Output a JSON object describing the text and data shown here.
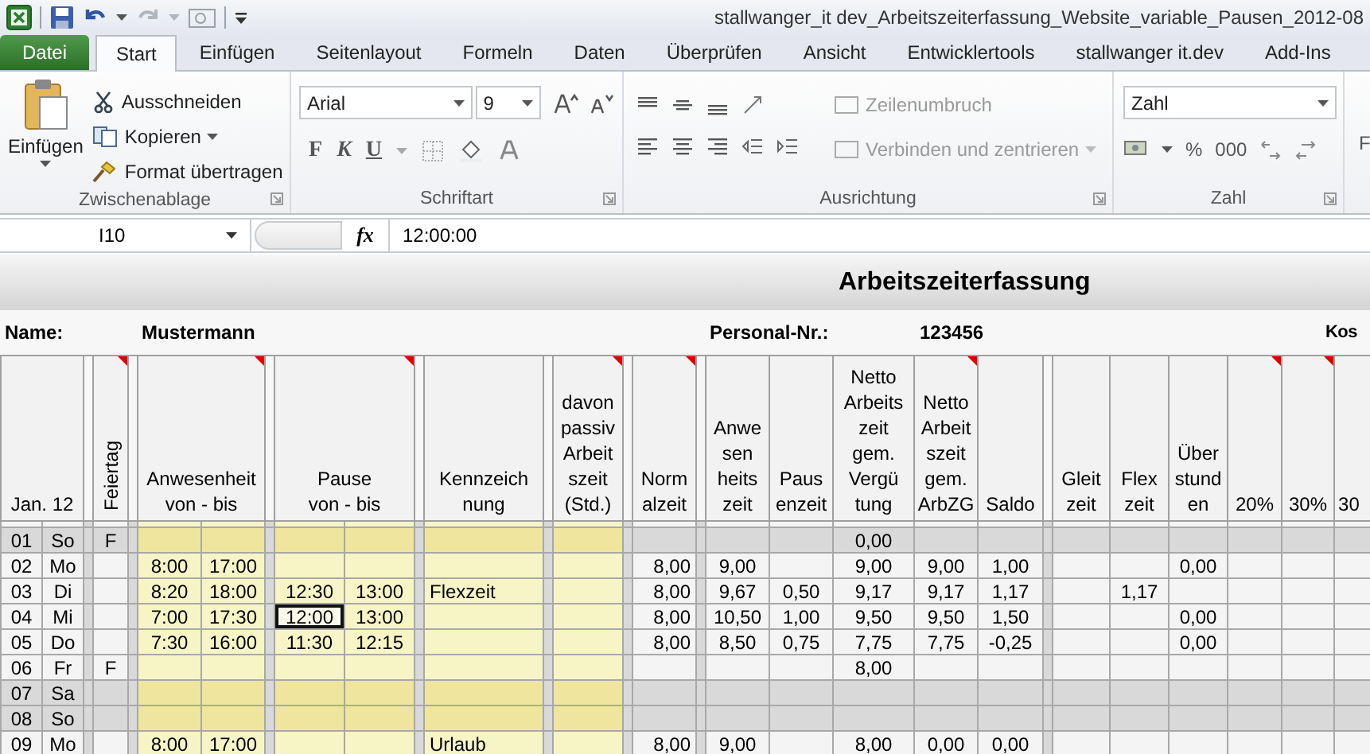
{
  "window": {
    "title": "stallwanger_it dev_Arbeitszeiterfassung_Website_variable_Pausen_2012-08"
  },
  "tabs": [
    {
      "label": "Datei",
      "kind": "file",
      "selected": false
    },
    {
      "label": "Start",
      "kind": "tab",
      "selected": true
    },
    {
      "label": "Einfügen",
      "kind": "tab",
      "selected": false
    },
    {
      "label": "Seitenlayout",
      "kind": "tab",
      "selected": false
    },
    {
      "label": "Formeln",
      "kind": "tab",
      "selected": false
    },
    {
      "label": "Daten",
      "kind": "tab",
      "selected": false
    },
    {
      "label": "Überprüfen",
      "kind": "tab",
      "selected": false
    },
    {
      "label": "Ansicht",
      "kind": "tab",
      "selected": false
    },
    {
      "label": "Entwicklertools",
      "kind": "tab",
      "selected": false
    },
    {
      "label": "stallwanger it.dev",
      "kind": "tab",
      "selected": false
    },
    {
      "label": "Add-Ins",
      "kind": "tab",
      "selected": false
    }
  ],
  "ribbon": {
    "groups": [
      {
        "kind": "clipboard",
        "label": "Zwischenablage",
        "paste": "Einfügen",
        "items": [
          {
            "kind": "cut",
            "label": "Ausschneiden"
          },
          {
            "kind": "copy",
            "label": "Kopieren"
          },
          {
            "kind": "painter",
            "label": "Format übertragen"
          }
        ]
      },
      {
        "kind": "font",
        "label": "Schriftart",
        "font": "Arial",
        "size": "9",
        "bold": "F",
        "italic": "K",
        "underline": "U"
      },
      {
        "kind": "alignment",
        "label": "Ausrichtung",
        "buttons": [
          {
            "kind": "wrap",
            "label": "Zeilenumbruch",
            "disabled": true
          },
          {
            "kind": "merge",
            "label": "Verbinden und zentrieren",
            "disabled": true
          }
        ]
      },
      {
        "kind": "number",
        "label": "Zahl",
        "format": "Zahl",
        "percent": "%",
        "thousands": "000"
      },
      {
        "kind": "partial",
        "label": "F"
      }
    ]
  },
  "formula_bar": {
    "cell": "I10",
    "function_button": "fx",
    "formula": "12:00:00"
  },
  "sheet": {
    "title": "Arbeitszeiterfassung",
    "name_label": "Name:",
    "name": "Mustermann",
    "personal_label": "Personal-Nr.:",
    "personal_number": "123456",
    "cut_label": "Kos",
    "header": [
      {
        "kind": "double",
        "text": "Jan. 12",
        "comment": false
      },
      {
        "kind": "spacer"
      },
      {
        "kind": "vertical",
        "text": "Feiertag",
        "comment": true
      },
      {
        "kind": "spacer"
      },
      {
        "kind": "pair",
        "text": "Anwesenheit\nvon - bis",
        "comment": true
      },
      {
        "kind": "spacer"
      },
      {
        "kind": "pair",
        "text": "Pause\nvon - bis",
        "comment": true
      },
      {
        "kind": "spacer"
      },
      {
        "kind": "single",
        "text": "Kennzeich\nnung",
        "comment": false
      },
      {
        "kind": "spacer"
      },
      {
        "kind": "single",
        "text": "davon\npassiv\nArbeit\nszeit\n(Std.)",
        "comment": true
      },
      {
        "kind": "spacer"
      },
      {
        "kind": "single",
        "text": "Norm\nalzeit",
        "comment": true
      },
      {
        "kind": "spacer"
      },
      {
        "kind": "single",
        "text": "Anwe\nsen\nheits\nzeit",
        "comment": false
      },
      {
        "kind": "single",
        "text": "Paus\nenzeit",
        "comment": false
      },
      {
        "kind": "single",
        "text": "Netto\nArbeits\nzeit\ngem.\nVergü\ntung",
        "comment": false
      },
      {
        "kind": "single",
        "text": "Netto\nArbeit\nszeit\ngem.\nArbZG",
        "comment": true
      },
      {
        "kind": "single",
        "text": "Saldo",
        "comment": false
      },
      {
        "kind": "spacer"
      },
      {
        "kind": "single",
        "text": "Gleit\nzeit",
        "comment": false
      },
      {
        "kind": "single",
        "text": "Flex\nzeit",
        "comment": false
      },
      {
        "kind": "single",
        "text": "Über\nstund\nen",
        "comment": false
      },
      {
        "kind": "single",
        "text": "20%",
        "comment": true
      },
      {
        "kind": "single",
        "text": "30%",
        "comment": true
      },
      {
        "kind": "single",
        "text": "30",
        "comment": false
      }
    ],
    "rows": [
      {
        "day": "01",
        "weekday": "So",
        "weekend": true,
        "selected": false,
        "holiday": "F",
        "net_pay": "0,00"
      },
      {
        "day": "02",
        "weekday": "Mo",
        "weekend": false,
        "selected": false,
        "presence_from": "8:00",
        "presence_to": "17:00",
        "normal": "8,00",
        "presence_hours": "9,00",
        "net_pay": "9,00",
        "net_arbzg": "9,00",
        "balance": "1,00",
        "overtime": "0,00"
      },
      {
        "day": "03",
        "weekday": "Di",
        "weekend": false,
        "selected": false,
        "presence_from": "8:20",
        "presence_to": "18:00",
        "break_from": "12:30",
        "break_to": "13:00",
        "remark": "Flexzeit",
        "normal": "8,00",
        "presence_hours": "9,67",
        "break_hours": "0,50",
        "net_pay": "9,17",
        "net_arbzg": "9,17",
        "balance": "1,17",
        "flex": "1,17"
      },
      {
        "day": "04",
        "weekday": "Mi",
        "weekend": false,
        "selected": true,
        "presence_from": "7:00",
        "presence_to": "17:30",
        "break_from": "12:00",
        "break_to": "13:00",
        "normal": "8,00",
        "presence_hours": "10,50",
        "break_hours": "1,00",
        "net_pay": "9,50",
        "net_arbzg": "9,50",
        "balance": "1,50",
        "overtime": "0,00"
      },
      {
        "day": "05",
        "weekday": "Do",
        "weekend": false,
        "selected": false,
        "presence_from": "7:30",
        "presence_to": "16:00",
        "break_from": "11:30",
        "break_to": "12:15",
        "normal": "8,00",
        "presence_hours": "8,50",
        "break_hours": "0,75",
        "net_pay": "7,75",
        "net_arbzg": "7,75",
        "balance": "-0,25",
        "overtime": "0,00"
      },
      {
        "day": "06",
        "weekday": "Fr",
        "weekend": false,
        "selected": false,
        "holiday": "F",
        "net_pay": "8,00"
      },
      {
        "day": "07",
        "weekday": "Sa",
        "weekend": true,
        "selected": false
      },
      {
        "day": "08",
        "weekday": "So",
        "weekend": true,
        "selected": false
      },
      {
        "day": "09",
        "weekday": "Mo",
        "weekend": false,
        "selected": false,
        "presence_from": "8:00",
        "presence_to": "17:00",
        "remark": "Urlaub",
        "normal": "8,00",
        "presence_hours": "9,00",
        "net_pay": "8,00",
        "net_arbzg": "0,00",
        "balance": "0,00"
      }
    ]
  }
}
